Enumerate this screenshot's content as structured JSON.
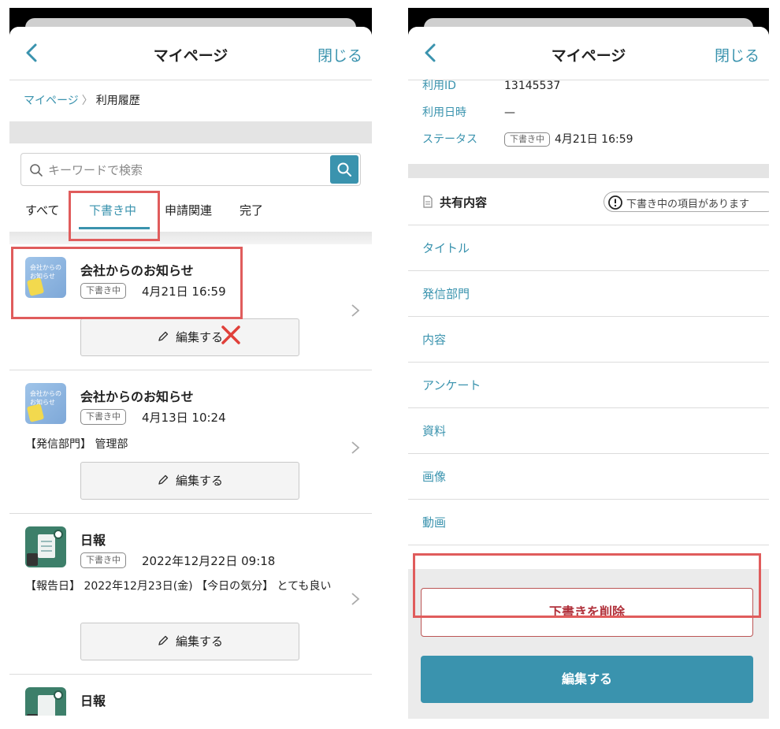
{
  "left": {
    "nav": {
      "title": "マイページ",
      "close": "閉じる"
    },
    "breadcrumb": {
      "home": "マイページ",
      "separator": "〉",
      "current": "利用履歴"
    },
    "search": {
      "placeholder": "キーワードで検索"
    },
    "tabs": [
      "すべて",
      "下書き中",
      "申請関連",
      "完了"
    ],
    "active_tab": "下書き中",
    "items": [
      {
        "title": "会社からのお知らせ",
        "badge": "下書き中",
        "datetime": "4月21日 16:59",
        "thumb_text": "会社からの\nお知らせ",
        "edit_label": "編集する"
      },
      {
        "title": "会社からのお知らせ",
        "badge": "下書き中",
        "datetime": "4月13日 10:24",
        "thumb_text": "会社からの\nお知らせ",
        "description": "【発信部門】 管理部",
        "edit_label": "編集する"
      },
      {
        "title": "日報",
        "badge": "下書き中",
        "datetime": "2022年12月22日 09:18",
        "description": "【報告日】 2022年12月23日(金) 【今日の気分】 とても良い",
        "edit_label": "編集する"
      },
      {
        "title": "日報"
      }
    ]
  },
  "right": {
    "nav": {
      "title": "マイページ",
      "close": "閉じる"
    },
    "details": [
      {
        "label": "利用ID",
        "value": "13145537"
      },
      {
        "label": "利用日時",
        "value": "—"
      },
      {
        "label": "ステータス",
        "badge": "下書き中",
        "value": "4月21日 16:59"
      }
    ],
    "section": {
      "title": "共有内容",
      "notice": "下書き中の項目があります"
    },
    "fields": [
      "タイトル",
      "発信部門",
      "内容",
      "アンケート",
      "資料",
      "画像",
      "動画"
    ],
    "delete_label": "下書きを削除",
    "edit_label": "編集する"
  },
  "colors": {
    "accent": "#3a93ae",
    "highlight": "#e05c5c",
    "delete_text": "#b0303a"
  }
}
